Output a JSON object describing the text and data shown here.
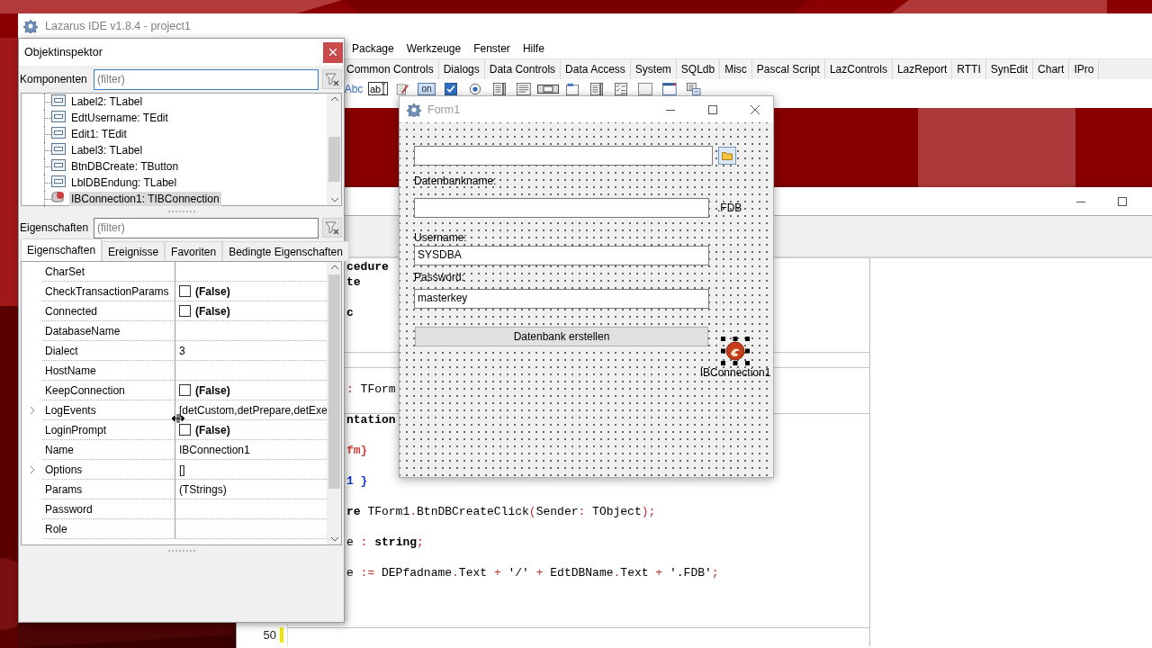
{
  "ide_window": {
    "title": "Lazarus IDE v1.8.4 - project1",
    "menu": [
      "Package",
      "Werkzeuge",
      "Fenster",
      "Hilfe"
    ],
    "palette_tabs": [
      "Common Controls",
      "Dialogs",
      "Data Controls",
      "Data Access",
      "System",
      "SQLdb",
      "Misc",
      "Pascal Script",
      "LazControls",
      "LazReport",
      "RTTI",
      "SynEdit",
      "Chart",
      "IPro"
    ],
    "palette_icons": [
      {
        "kind": "label",
        "text": "Abc"
      },
      {
        "kind": "edit",
        "text": "ab"
      },
      {
        "kind": "memo"
      },
      {
        "kind": "toggle",
        "text": "on"
      },
      {
        "kind": "checkbox"
      },
      {
        "kind": "radio"
      },
      {
        "kind": "listbox"
      },
      {
        "kind": "textlist"
      },
      {
        "kind": "scrollbar"
      },
      {
        "kind": "groupbox"
      },
      {
        "kind": "listbox"
      },
      {
        "kind": "checklist"
      },
      {
        "kind": "panel"
      },
      {
        "kind": "frame"
      },
      {
        "kind": "actionlist"
      }
    ]
  },
  "source_editor": {
    "lines": [
      {
        "kind": "code",
        "segments": [
          {
            "text": "cedure",
            "kind": "keyword"
          }
        ]
      },
      {
        "kind": "code",
        "segments": [
          {
            "text": "te",
            "kind": "keyword"
          }
        ]
      },
      {
        "kind": "blank"
      },
      {
        "kind": "code",
        "segments": [
          {
            "text": "c",
            "kind": "keyword"
          }
        ]
      },
      {
        "kind": "blank"
      },
      {
        "kind": "blank"
      },
      {
        "kind": "blank",
        "divider_above": true
      },
      {
        "kind": "blank",
        "divider_above": true
      },
      {
        "kind": "code",
        "segments": [
          {
            "text": ":",
            "kind": "symbol"
          },
          {
            "text": " TForm",
            "kind": "plain"
          }
        ]
      },
      {
        "kind": "blank"
      },
      {
        "kind": "code",
        "divider_above": true,
        "segments": [
          {
            "text": "ntation",
            "kind": "keyword"
          }
        ]
      },
      {
        "kind": "blank"
      },
      {
        "kind": "code",
        "segments": [
          {
            "text": "fm}",
            "kind": "directive"
          }
        ]
      },
      {
        "kind": "blank"
      },
      {
        "kind": "code",
        "segments": [
          {
            "text": "1 }",
            "kind": "comment"
          }
        ]
      },
      {
        "kind": "blank"
      },
      {
        "kind": "code",
        "segments": [
          {
            "text": "re",
            "kind": "keyword"
          },
          {
            "text": " TForm1",
            "kind": "plain"
          },
          {
            "text": ".",
            "kind": "symbol"
          },
          {
            "text": "BtnDBCreateClick",
            "kind": "plain"
          },
          {
            "text": "(",
            "kind": "symbol"
          },
          {
            "text": "Sender",
            "kind": "plain"
          },
          {
            "text": ":",
            "kind": "symbol"
          },
          {
            "text": " TObject",
            "kind": "plain"
          },
          {
            "text": ");",
            "kind": "symbol"
          }
        ]
      },
      {
        "kind": "blank"
      },
      {
        "kind": "code",
        "segments": [
          {
            "text": "e ",
            "kind": "plain"
          },
          {
            "text": ":",
            "kind": "symbol"
          },
          {
            "text": " string",
            "kind": "keyword"
          },
          {
            "text": ";",
            "kind": "symbol"
          }
        ]
      },
      {
        "kind": "blank"
      },
      {
        "kind": "code",
        "segments": [
          {
            "text": "e ",
            "kind": "plain"
          },
          {
            "text": ":=",
            "kind": "symbol"
          },
          {
            "text": " DEPfadname",
            "kind": "plain"
          },
          {
            "text": ".",
            "kind": "symbol"
          },
          {
            "text": "Text ",
            "kind": "plain"
          },
          {
            "text": "+",
            "kind": "symbol"
          },
          {
            "text": " '/' ",
            "kind": "plain"
          },
          {
            "text": "+",
            "kind": "symbol"
          },
          {
            "text": " EdtDBName",
            "kind": "plain"
          },
          {
            "text": ".",
            "kind": "symbol"
          },
          {
            "text": "Text ",
            "kind": "plain"
          },
          {
            "text": "+",
            "kind": "symbol"
          },
          {
            "text": " '.FDB'",
            "kind": "plain"
          },
          {
            "text": ";",
            "kind": "symbol"
          }
        ]
      },
      {
        "kind": "blank"
      },
      {
        "kind": "blank"
      },
      {
        "kind": "blank"
      },
      {
        "kind": "blank",
        "number": "50",
        "modified": true,
        "divider_above": true
      }
    ]
  },
  "form": {
    "title": "Form1",
    "controls": [
      {
        "kind": "directory_edit"
      },
      {
        "kind": "label",
        "text": "Datenbankname:"
      },
      {
        "kind": "edit"
      },
      {
        "kind": "label",
        "text": ".FDB"
      },
      {
        "kind": "label",
        "text": "Username:"
      },
      {
        "kind": "edit",
        "value": "SYSDBA"
      },
      {
        "kind": "label",
        "text": "Password:"
      },
      {
        "kind": "edit",
        "value": "masterkey"
      },
      {
        "kind": "button",
        "text": "Datenbank erstellen"
      },
      {
        "kind": "component",
        "text": "IBConnection1",
        "selected": true
      }
    ]
  },
  "object_inspector": {
    "title": "Objektinspektor",
    "components_label": "Komponenten",
    "components_filter": {
      "placeholder": "(filter)"
    },
    "tree": [
      {
        "label": "Label2: TLabel",
        "kind": "control",
        "selected": false
      },
      {
        "label": "EdtUsername: TEdit",
        "kind": "control",
        "selected": false
      },
      {
        "label": "Edit1: TEdit",
        "kind": "control",
        "selected": false
      },
      {
        "label": "Label3: TLabel",
        "kind": "control",
        "selected": false
      },
      {
        "label": "BtnDBCreate: TButton",
        "kind": "control",
        "selected": false
      },
      {
        "label": "LblDBEndung: TLabel",
        "kind": "control",
        "selected": false
      },
      {
        "label": "IBConnection1: TIBConnection",
        "kind": "database",
        "selected": true
      }
    ],
    "properties_label": "Eigenschaften",
    "properties_filter": {
      "placeholder": "(filter)"
    },
    "tabs": [
      {
        "label": "Eigenschaften",
        "selected": true
      },
      {
        "label": "Ereignisse",
        "selected": false
      },
      {
        "label": "Favoriten",
        "selected": false
      },
      {
        "label": "Bedingte Eigenschaften",
        "selected": false
      }
    ],
    "properties": [
      {
        "name": "CharSet",
        "kind": "text"
      },
      {
        "name": "CheckTransactionParams",
        "kind": "boolean",
        "value": "(False)",
        "checked": false
      },
      {
        "name": "Connected",
        "kind": "boolean",
        "value": "(False)",
        "checked": false
      },
      {
        "name": "DatabaseName",
        "kind": "text"
      },
      {
        "name": "Dialect",
        "kind": "text",
        "value": "3"
      },
      {
        "name": "HostName",
        "kind": "text"
      },
      {
        "name": "KeepConnection",
        "kind": "boolean",
        "value": "(False)",
        "checked": false
      },
      {
        "name": "LogEvents",
        "kind": "set",
        "value": "[detCustom,detPrepare,detExe",
        "expanded": false
      },
      {
        "name": "LoginPrompt",
        "kind": "boolean",
        "value": "(False)",
        "checked": false
      },
      {
        "name": "Name",
        "kind": "text",
        "value": "IBConnection1"
      },
      {
        "name": "Options",
        "kind": "set",
        "value": "[]",
        "expanded": false
      },
      {
        "name": "Params",
        "kind": "text",
        "value": "(TStrings)"
      },
      {
        "name": "Password",
        "kind": "text"
      },
      {
        "name": "Role",
        "kind": "text"
      }
    ]
  }
}
